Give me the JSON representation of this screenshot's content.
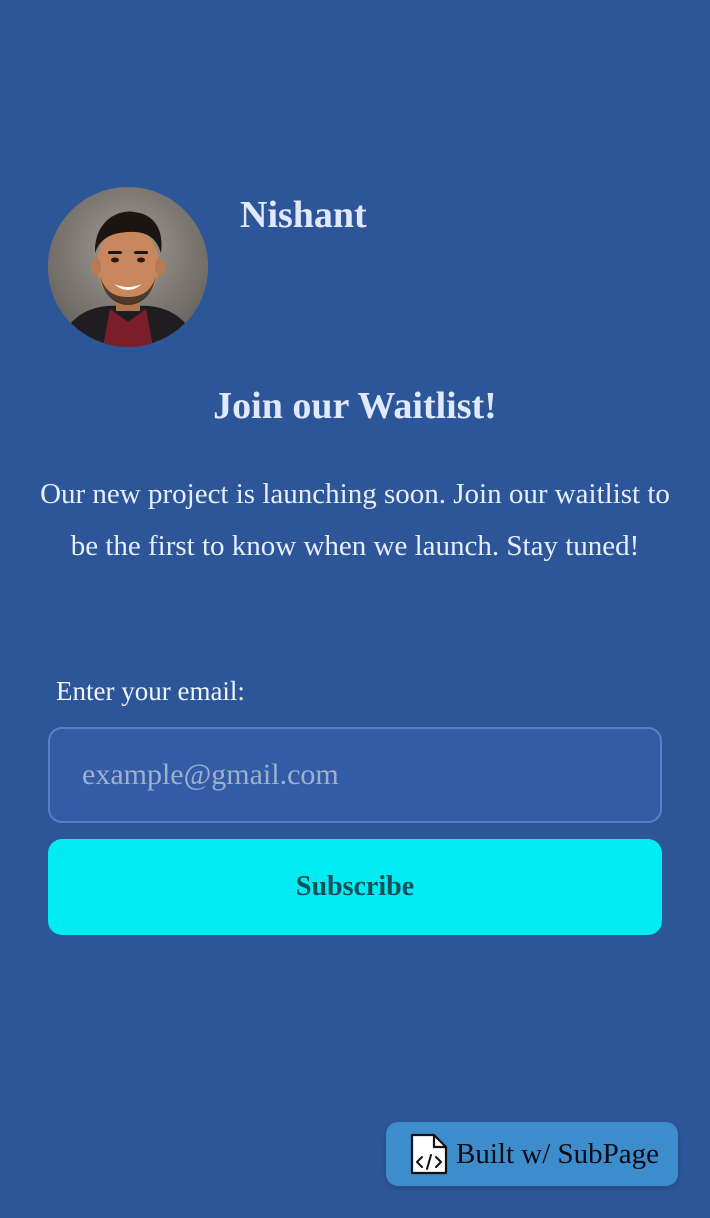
{
  "profile": {
    "name": "Nishant",
    "avatar_alt": "profile photo"
  },
  "waitlist": {
    "headline": "Join our Waitlist!",
    "description": "Our new project is launching soon. Join our waitlist to be the first to know when we launch. Stay tuned!",
    "email_label": "Enter your email:",
    "email_placeholder": "example@gmail.com",
    "email_value": "",
    "subscribe_label": "Subscribe"
  },
  "badge": {
    "label": "Built w/ SubPage",
    "icon": "code-file-icon"
  },
  "colors": {
    "background": "#2d5699",
    "button": "#00ebf2",
    "button_text": "#10505a",
    "badge": "#3d8ccc"
  }
}
